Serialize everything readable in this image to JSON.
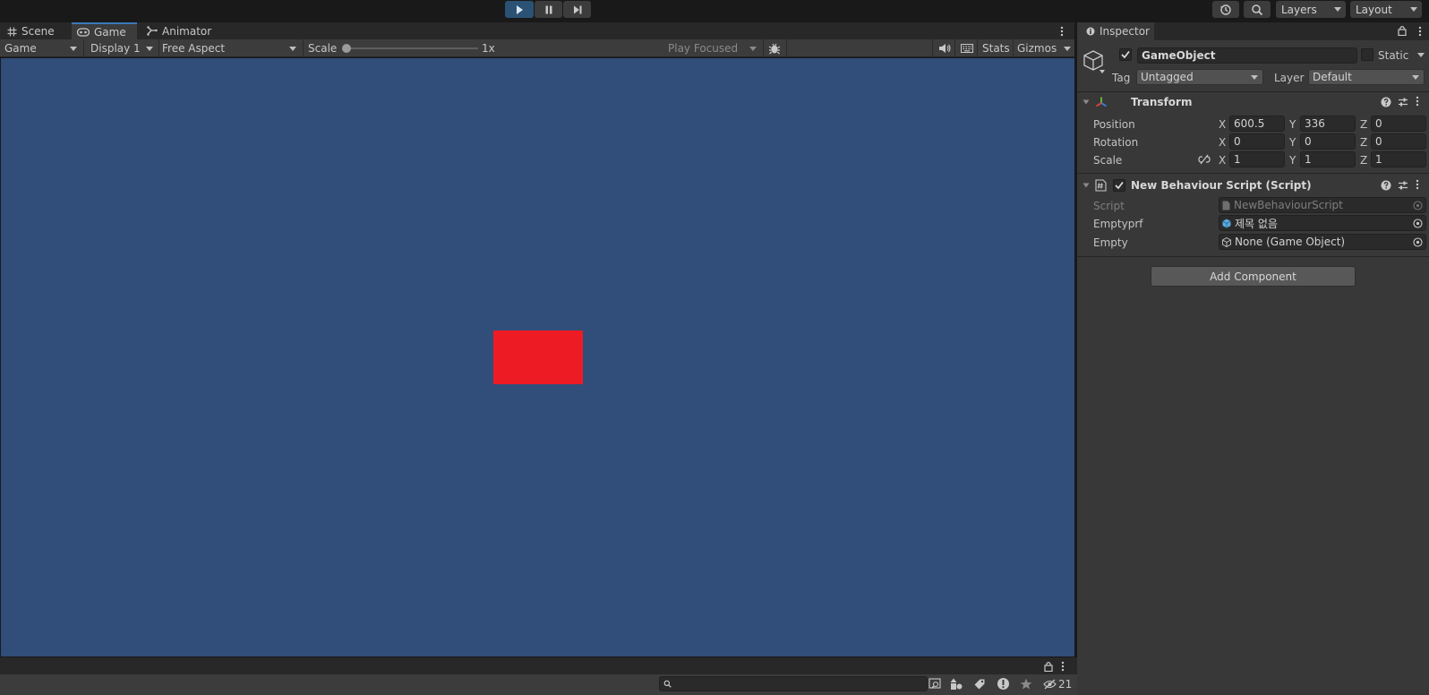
{
  "toolbar": {
    "layers_label": "Layers",
    "layout_label": "Layout"
  },
  "game_panel": {
    "tabs": [
      {
        "label": "Scene"
      },
      {
        "label": "Game"
      },
      {
        "label": "Animator"
      }
    ],
    "bar": {
      "view_select": "Game",
      "display_select": "Display 1",
      "aspect_select": "Free Aspect",
      "scale_label": "Scale",
      "scale_value": "1x",
      "play_mode_select": "Play Focused",
      "stats_label": "Stats",
      "gizmos_label": "Gizmos"
    }
  },
  "console": {
    "hidden_count": "21"
  },
  "inspector": {
    "tab_label": "Inspector",
    "object_name": "GameObject",
    "static_label": "Static",
    "tag_label": "Tag",
    "tag_value": "Untagged",
    "layer_label": "Layer",
    "layer_value": "Default",
    "transform": {
      "title": "Transform",
      "position_label": "Position",
      "rotation_label": "Rotation",
      "scale_label": "Scale",
      "axis_x": "X",
      "axis_y": "Y",
      "axis_z": "Z",
      "position": {
        "x": "600.5",
        "y": "336",
        "z": "0"
      },
      "rotation": {
        "x": "0",
        "y": "0",
        "z": "0"
      },
      "scale": {
        "x": "1",
        "y": "1",
        "z": "1"
      }
    },
    "script_component": {
      "title": "New Behaviour Script (Script)",
      "script_label": "Script",
      "script_value": "NewBehaviourScript",
      "emptyprf_label": "Emptyprf",
      "emptyprf_value": "제목 없음",
      "empty_label": "Empty",
      "empty_value": "None (Game Object)"
    },
    "add_component_label": "Add Component"
  },
  "colors": {
    "viewport_background": "#314d79",
    "red_object": "#ed1c24",
    "play_active": "#2b5275"
  }
}
